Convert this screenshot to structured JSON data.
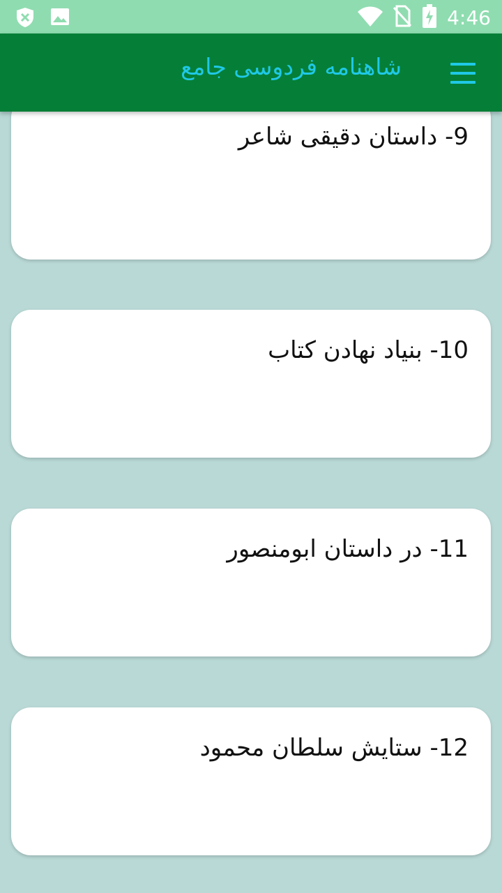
{
  "status_bar": {
    "time": "4:46",
    "icons": [
      "shield-x-icon",
      "image-icon",
      "wifi-icon",
      "no-sim-icon",
      "battery-charging-icon"
    ]
  },
  "app_bar": {
    "title": "شاهنامه فردوسی جامع",
    "menu_icon": "hamburger-menu-icon"
  },
  "items": [
    {
      "label": "9- داستان دقیقی شاعر"
    },
    {
      "label": "10- بنیاد نهادن کتاب"
    },
    {
      "label": "11- در داستان ابومنصور"
    },
    {
      "label": "12- ستایش سلطان محمود"
    }
  ],
  "colors": {
    "status_bar": "#8fdcb0",
    "app_bar": "#057f37",
    "accent": "#1fc8e6",
    "background": "#b9d9d6",
    "card": "#ffffff"
  }
}
